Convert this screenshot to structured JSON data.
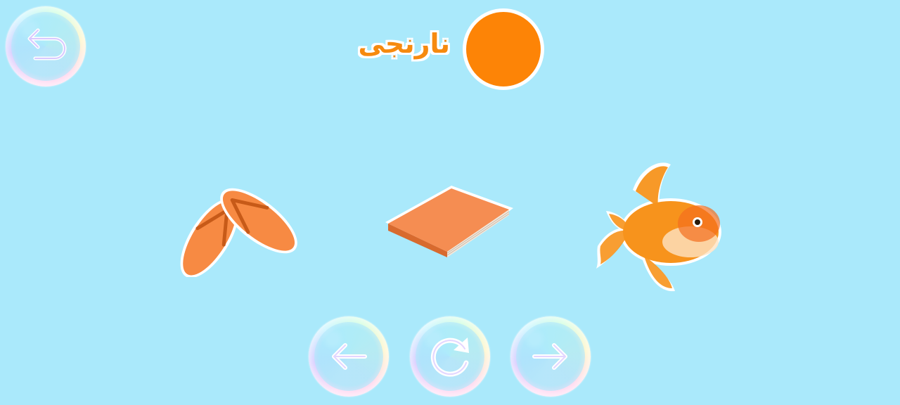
{
  "screen": {
    "background": "#aae9fb"
  },
  "color": {
    "name": "نارنجی",
    "swatch": "#fd8406"
  },
  "items": [
    {
      "name": "flip-flops",
      "color": "#f78a43"
    },
    {
      "name": "book",
      "color": "#f58d52"
    },
    {
      "name": "goldfish",
      "color": "#f7931c"
    }
  ],
  "controls": {
    "back_icon": "return-arrow-icon",
    "prev_icon": "arrow-left-icon",
    "replay_icon": "refresh-icon",
    "next_icon": "arrow-right-icon"
  }
}
